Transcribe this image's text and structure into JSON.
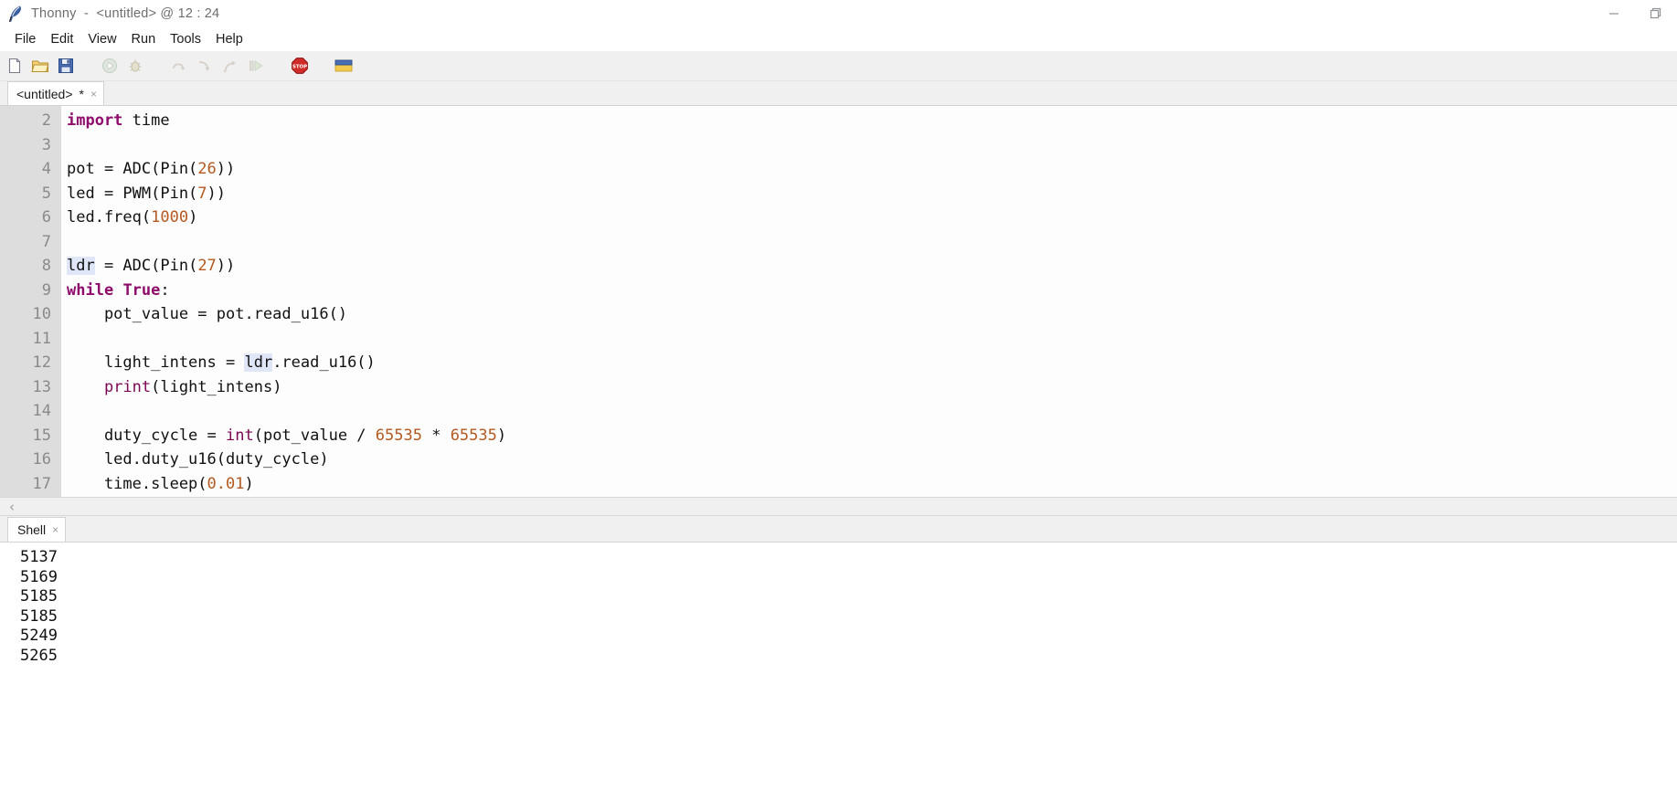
{
  "window": {
    "app_name": "Thonny",
    "title": "Thonny  -  <untitled> @ 12 : 24",
    "app_icon": "feather-icon",
    "controls": [
      {
        "name": "minimize-button",
        "glyph": "minimize-icon"
      },
      {
        "name": "restore-button",
        "glyph": "restore-icon"
      }
    ]
  },
  "menubar": {
    "items": [
      {
        "label": "File"
      },
      {
        "label": "Edit"
      },
      {
        "label": "View"
      },
      {
        "label": "Run"
      },
      {
        "label": "Tools"
      },
      {
        "label": "Help"
      }
    ]
  },
  "toolbar": {
    "buttons": [
      {
        "name": "new-file-button",
        "icon": "new-file-icon",
        "enabled": true
      },
      {
        "name": "open-file-button",
        "icon": "open-folder-icon",
        "enabled": true
      },
      {
        "name": "save-file-button",
        "icon": "save-disk-icon",
        "enabled": true
      },
      {
        "name": "run-button",
        "icon": "run-play-icon",
        "enabled": false
      },
      {
        "name": "debug-button",
        "icon": "debug-bug-icon",
        "enabled": false
      },
      {
        "name": "step-over-button",
        "icon": "step-over-icon",
        "enabled": false
      },
      {
        "name": "step-into-button",
        "icon": "step-into-icon",
        "enabled": false
      },
      {
        "name": "step-out-button",
        "icon": "step-out-icon",
        "enabled": false
      },
      {
        "name": "resume-button",
        "icon": "resume-icon",
        "enabled": false
      },
      {
        "name": "stop-button",
        "icon": "stop-sign-icon",
        "enabled": true
      },
      {
        "name": "device-button",
        "icon": "micropython-device-icon",
        "enabled": true
      }
    ]
  },
  "editor": {
    "tab": {
      "label": "<untitled>",
      "modified_marker": "*",
      "close": "×"
    },
    "first_line_number": 2,
    "lines": [
      {
        "num": 2,
        "tokens": [
          {
            "t": "import",
            "c": "kw"
          },
          {
            "t": " time",
            "c": ""
          }
        ]
      },
      {
        "num": 3,
        "tokens": []
      },
      {
        "num": 4,
        "tokens": [
          {
            "t": "pot = ADC(Pin(",
            "c": ""
          },
          {
            "t": "26",
            "c": "num"
          },
          {
            "t": "))",
            "c": ""
          }
        ]
      },
      {
        "num": 5,
        "tokens": [
          {
            "t": "led = PWM(Pin(",
            "c": ""
          },
          {
            "t": "7",
            "c": "num"
          },
          {
            "t": "))",
            "c": ""
          }
        ]
      },
      {
        "num": 6,
        "tokens": [
          {
            "t": "led.freq(",
            "c": ""
          },
          {
            "t": "1000",
            "c": "num"
          },
          {
            "t": ")",
            "c": ""
          }
        ]
      },
      {
        "num": 7,
        "tokens": []
      },
      {
        "num": 8,
        "tokens": [
          {
            "t": "ldr",
            "c": "hl"
          },
          {
            "t": " = ADC(Pin(",
            "c": ""
          },
          {
            "t": "27",
            "c": "num"
          },
          {
            "t": "))",
            "c": ""
          }
        ]
      },
      {
        "num": 9,
        "tokens": [
          {
            "t": "while",
            "c": "kw"
          },
          {
            "t": " ",
            "c": ""
          },
          {
            "t": "True",
            "c": "kw"
          },
          {
            "t": ":",
            "c": ""
          }
        ]
      },
      {
        "num": 10,
        "tokens": [
          {
            "t": "    pot_value = pot.read_u16()",
            "c": ""
          }
        ]
      },
      {
        "num": 11,
        "tokens": []
      },
      {
        "num": 12,
        "tokens": [
          {
            "t": "    light_intens = ",
            "c": ""
          },
          {
            "t": "ldr",
            "c": "hl"
          },
          {
            "t": ".read_u16()",
            "c": ""
          }
        ]
      },
      {
        "num": 13,
        "tokens": [
          {
            "t": "    ",
            "c": ""
          },
          {
            "t": "print",
            "c": "bi"
          },
          {
            "t": "(light_intens)",
            "c": ""
          }
        ]
      },
      {
        "num": 14,
        "tokens": []
      },
      {
        "num": 15,
        "tokens": [
          {
            "t": "    duty_cycle = ",
            "c": ""
          },
          {
            "t": "int",
            "c": "bi"
          },
          {
            "t": "(pot_value / ",
            "c": ""
          },
          {
            "t": "65535",
            "c": "num"
          },
          {
            "t": " * ",
            "c": ""
          },
          {
            "t": "65535",
            "c": "num"
          },
          {
            "t": ")",
            "c": ""
          }
        ]
      },
      {
        "num": 16,
        "tokens": [
          {
            "t": "    led.duty_u16(duty_cycle)",
            "c": ""
          }
        ]
      },
      {
        "num": 17,
        "tokens": [
          {
            "t": "    time.sleep(",
            "c": ""
          },
          {
            "t": "0.01",
            "c": "num"
          },
          {
            "t": ")",
            "c": ""
          }
        ]
      }
    ],
    "hscroll_left_arrow": "‹"
  },
  "shell": {
    "tab": {
      "label": "Shell",
      "close": "×"
    },
    "output": [
      "5137",
      "5169",
      "5185",
      "5185",
      "5249",
      "5265"
    ]
  },
  "colors": {
    "keyword": "#8e0b6b",
    "builtin": "#7d0552",
    "number": "#b4591f",
    "occurrence_highlight": "#dfe6f7",
    "gutter_bg": "#dddddd",
    "toolbar_bg": "#f0f0f0",
    "stop_red": "#cc2222"
  }
}
